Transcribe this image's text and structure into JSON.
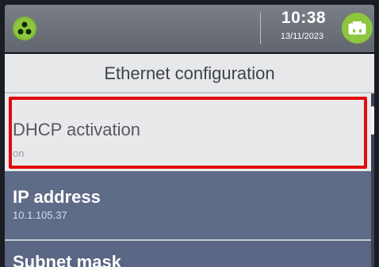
{
  "status": {
    "logo_icon": "green-circle-dots-icon",
    "time": "10:38",
    "date": "13/11/2023",
    "ethernet_icon": "ethernet-icon",
    "accent_color": "#8dc63f"
  },
  "header": {
    "title": "Ethernet configuration"
  },
  "items": [
    {
      "label": "DHCP activation",
      "value": "on",
      "selected": true
    },
    {
      "label": "IP address",
      "value": "10.1.105.37"
    },
    {
      "label": "Subnet mask",
      "value": ""
    }
  ],
  "highlight_color": "#e10b0b"
}
